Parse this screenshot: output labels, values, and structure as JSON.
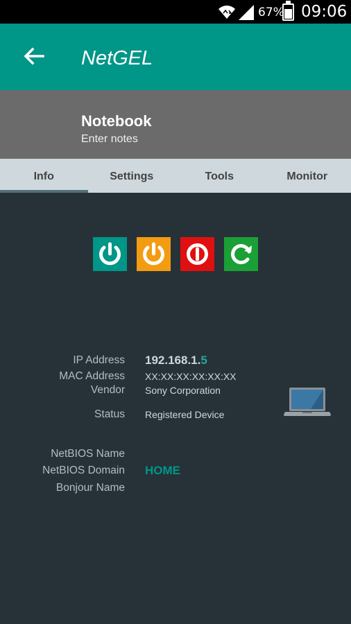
{
  "status_bar": {
    "battery_percent": "67%",
    "battery_level": 0.67,
    "time": "09:06"
  },
  "app_bar": {
    "title": "NetGEL",
    "color": "#009688"
  },
  "device_header": {
    "name": "Notebook",
    "notes_placeholder": "Enter notes"
  },
  "tabs": [
    {
      "label": "Info",
      "active": true
    },
    {
      "label": "Settings",
      "active": false
    },
    {
      "label": "Tools",
      "active": false
    },
    {
      "label": "Monitor",
      "active": false
    }
  ],
  "action_buttons": [
    {
      "icon": "power-on-icon",
      "color": "#009688"
    },
    {
      "icon": "power-standby-icon",
      "color": "#f39c12"
    },
    {
      "icon": "power-off-icon",
      "color": "#e01010"
    },
    {
      "icon": "reboot-icon",
      "color": "#1aa036"
    }
  ],
  "info": {
    "ip_label": "IP Address",
    "ip_prefix": "192.168.1.",
    "ip_last": "5",
    "mac_label": "MAC Address",
    "mac_value": "XX:XX:XX:XX:XX:XX",
    "vendor_label": "Vendor",
    "vendor_value": "Sony Corporation",
    "status_label": "Status",
    "status_value": "Registered Device",
    "netbios_name_label": "NetBIOS Name",
    "netbios_domain_label": "NetBIOS Domain",
    "netbios_domain_value": "HOME",
    "bonjour_name_label": "Bonjour Name"
  },
  "device_icon": "laptop-icon"
}
